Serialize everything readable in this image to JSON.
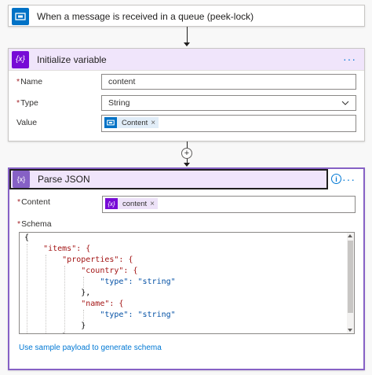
{
  "trigger": {
    "title": "When a message is received in a queue (peek-lock)",
    "icon": "service-bus-icon",
    "accent": "#0072c6"
  },
  "init_variable": {
    "title": "Initialize variable",
    "icon": "variable-icon",
    "accent": "#770bd6",
    "header_bg": "#f0e5fb",
    "name_label": "Name",
    "name_value": "content",
    "type_label": "Type",
    "type_value": "String",
    "value_label": "Value",
    "value_token": "Content",
    "value_token_remove": "×"
  },
  "connector": {
    "plus": "+"
  },
  "parse_json": {
    "title": "Parse JSON",
    "icon": "curly-braces-icon",
    "accent": "#770bd6",
    "content_label": "Content",
    "content_token": "content",
    "content_token_remove": "×",
    "schema_label": "Schema",
    "schema_lines": [
      "{",
      "    \"items\": {",
      "        \"properties\": {",
      "            \"country\": {",
      "                \"type\": \"string\"",
      "            },",
      "            \"name\": {",
      "                \"type\": \"string\"",
      "            }",
      "        },"
    ],
    "sample_link": "Use sample payload to generate schema"
  },
  "common": {
    "more_label": "···",
    "required_mark": "*",
    "info_label": "i",
    "var_icon_text": "{x}"
  }
}
